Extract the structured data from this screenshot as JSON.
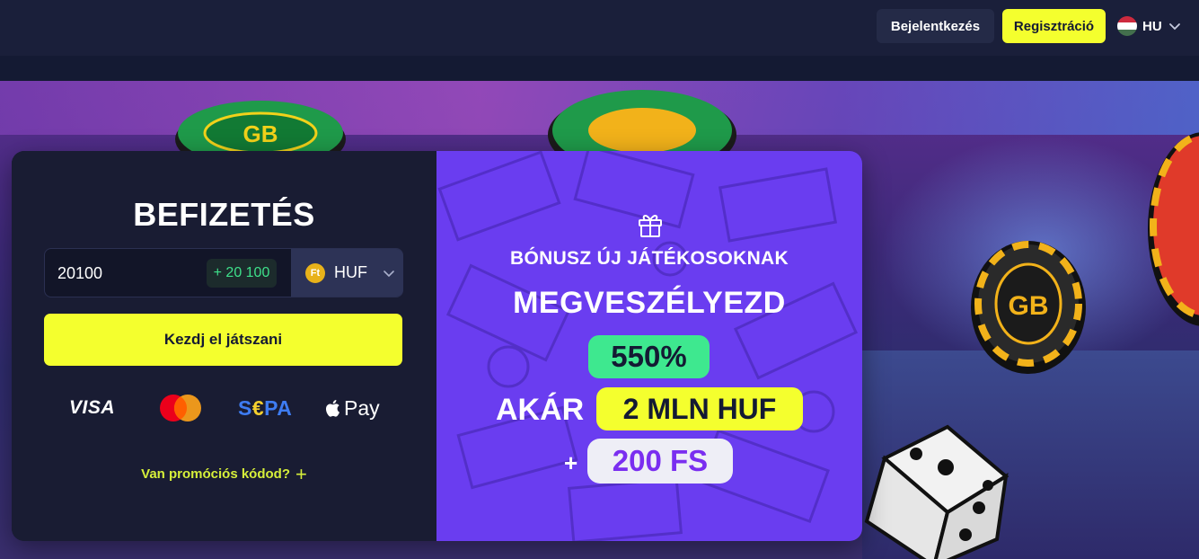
{
  "header": {
    "login_label": "Bejelentkezés",
    "register_label": "Regisztráció",
    "language": "HU",
    "flag_icon": "hungary-flag-icon",
    "colors": {
      "register_bg": "#f4ff2e",
      "bar_bg": "#1a1f3a"
    }
  },
  "deposit": {
    "title": "BEFIZETÉS",
    "amount_value": "20100",
    "amount_bonus": "+ 20 100",
    "currency_symbol": "Ft",
    "currency": "HUF",
    "play_button": "Kezdj el játszani",
    "payments": {
      "visa": "VISA",
      "mastercard_icon": "mastercard-icon",
      "sepa_s": "S",
      "sepa_e": "€",
      "sepa_pa": "PA",
      "apple_pay": "Pay"
    },
    "promo_label": "Van promóciós kódod?",
    "promo_plus": "+"
  },
  "bonus": {
    "gift_icon": "gift-icon",
    "label": "BÓNUSZ ÚJ JÁTÉKOSOKNAK",
    "headline": "MEGVESZÉLYEZD",
    "percent": "550%",
    "upto": "AKÁR",
    "amount": "2 MLN HUF",
    "plus": "+",
    "free_spins": "200 FS",
    "colors": {
      "panel": "#6a3df0",
      "percent_bg": "#3ee88f",
      "amount_bg": "#f4ff2e",
      "fs_text": "#7a2ef0"
    }
  }
}
